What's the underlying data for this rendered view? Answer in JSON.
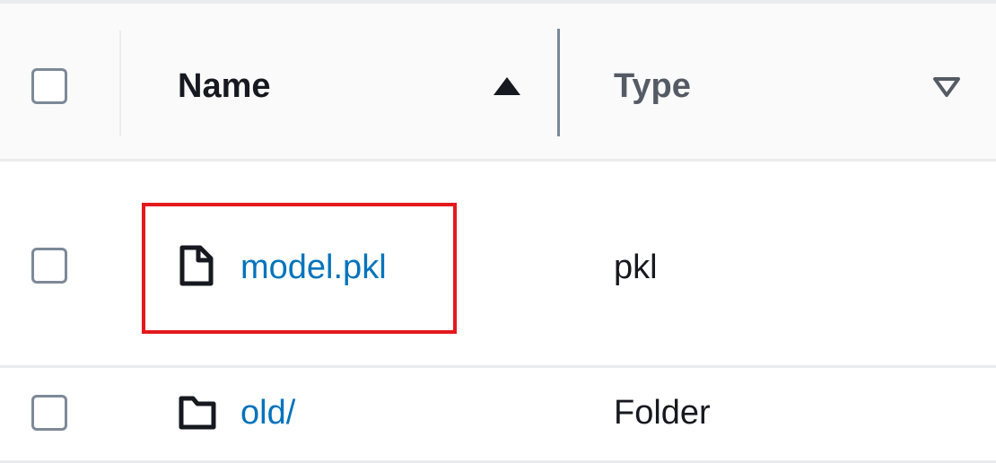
{
  "table": {
    "columns": [
      {
        "label": "Name",
        "sort": "ascending"
      },
      {
        "label": "Type",
        "sort": "none"
      }
    ],
    "rows": [
      {
        "name": "model.pkl",
        "type": "pkl",
        "icon": "file-icon",
        "highlighted": true
      },
      {
        "name": "old/",
        "type": "Folder",
        "icon": "folder-icon",
        "highlighted": false
      }
    ]
  },
  "colors": {
    "link": "#0073bb",
    "highlight": "#e3191c",
    "header_bg": "#fafafa",
    "border": "#e9ebed"
  }
}
